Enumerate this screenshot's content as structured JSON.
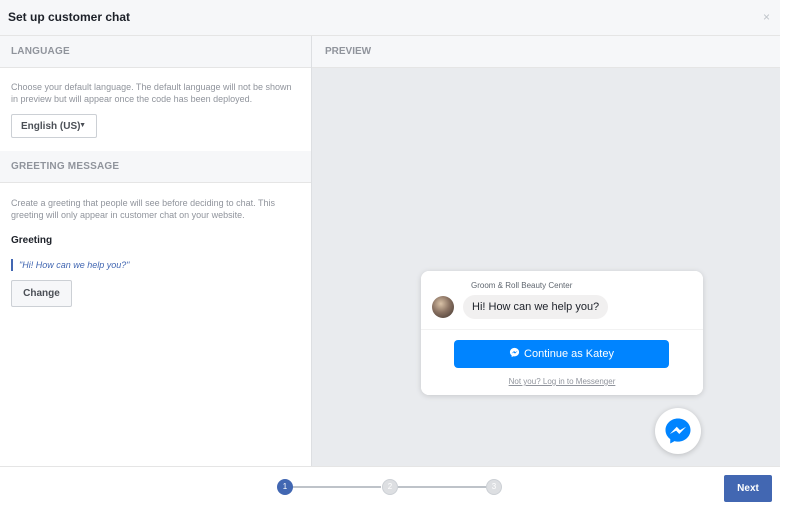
{
  "header": {
    "title": "Set up customer chat",
    "close_label": "×"
  },
  "language": {
    "section_title": "LANGUAGE",
    "description": "Choose your default language. The default language will not be shown in preview but will appear once the code has been deployed.",
    "selected": "English (US)"
  },
  "greeting": {
    "section_title": "GREETING MESSAGE",
    "description": "Create a greeting that people will see before deciding to chat. This greeting will only appear in customer chat on your website.",
    "label": "Greeting",
    "current": "\"Hi! How can we help you?\"",
    "change_label": "Change"
  },
  "preview": {
    "section_title": "PREVIEW",
    "page_name": "Groom & Roll Beauty Center",
    "bubble_text": "Hi! How can we help you?",
    "continue_label": "Continue as Katey",
    "not_you_label": "Not you? Log in to Messenger"
  },
  "stepper": {
    "steps": [
      "1",
      "2",
      "3"
    ],
    "current_step": 1
  },
  "footer": {
    "next_label": "Next"
  },
  "colors": {
    "brand_blue": "#4267b2",
    "messenger_blue": "#0084ff"
  }
}
